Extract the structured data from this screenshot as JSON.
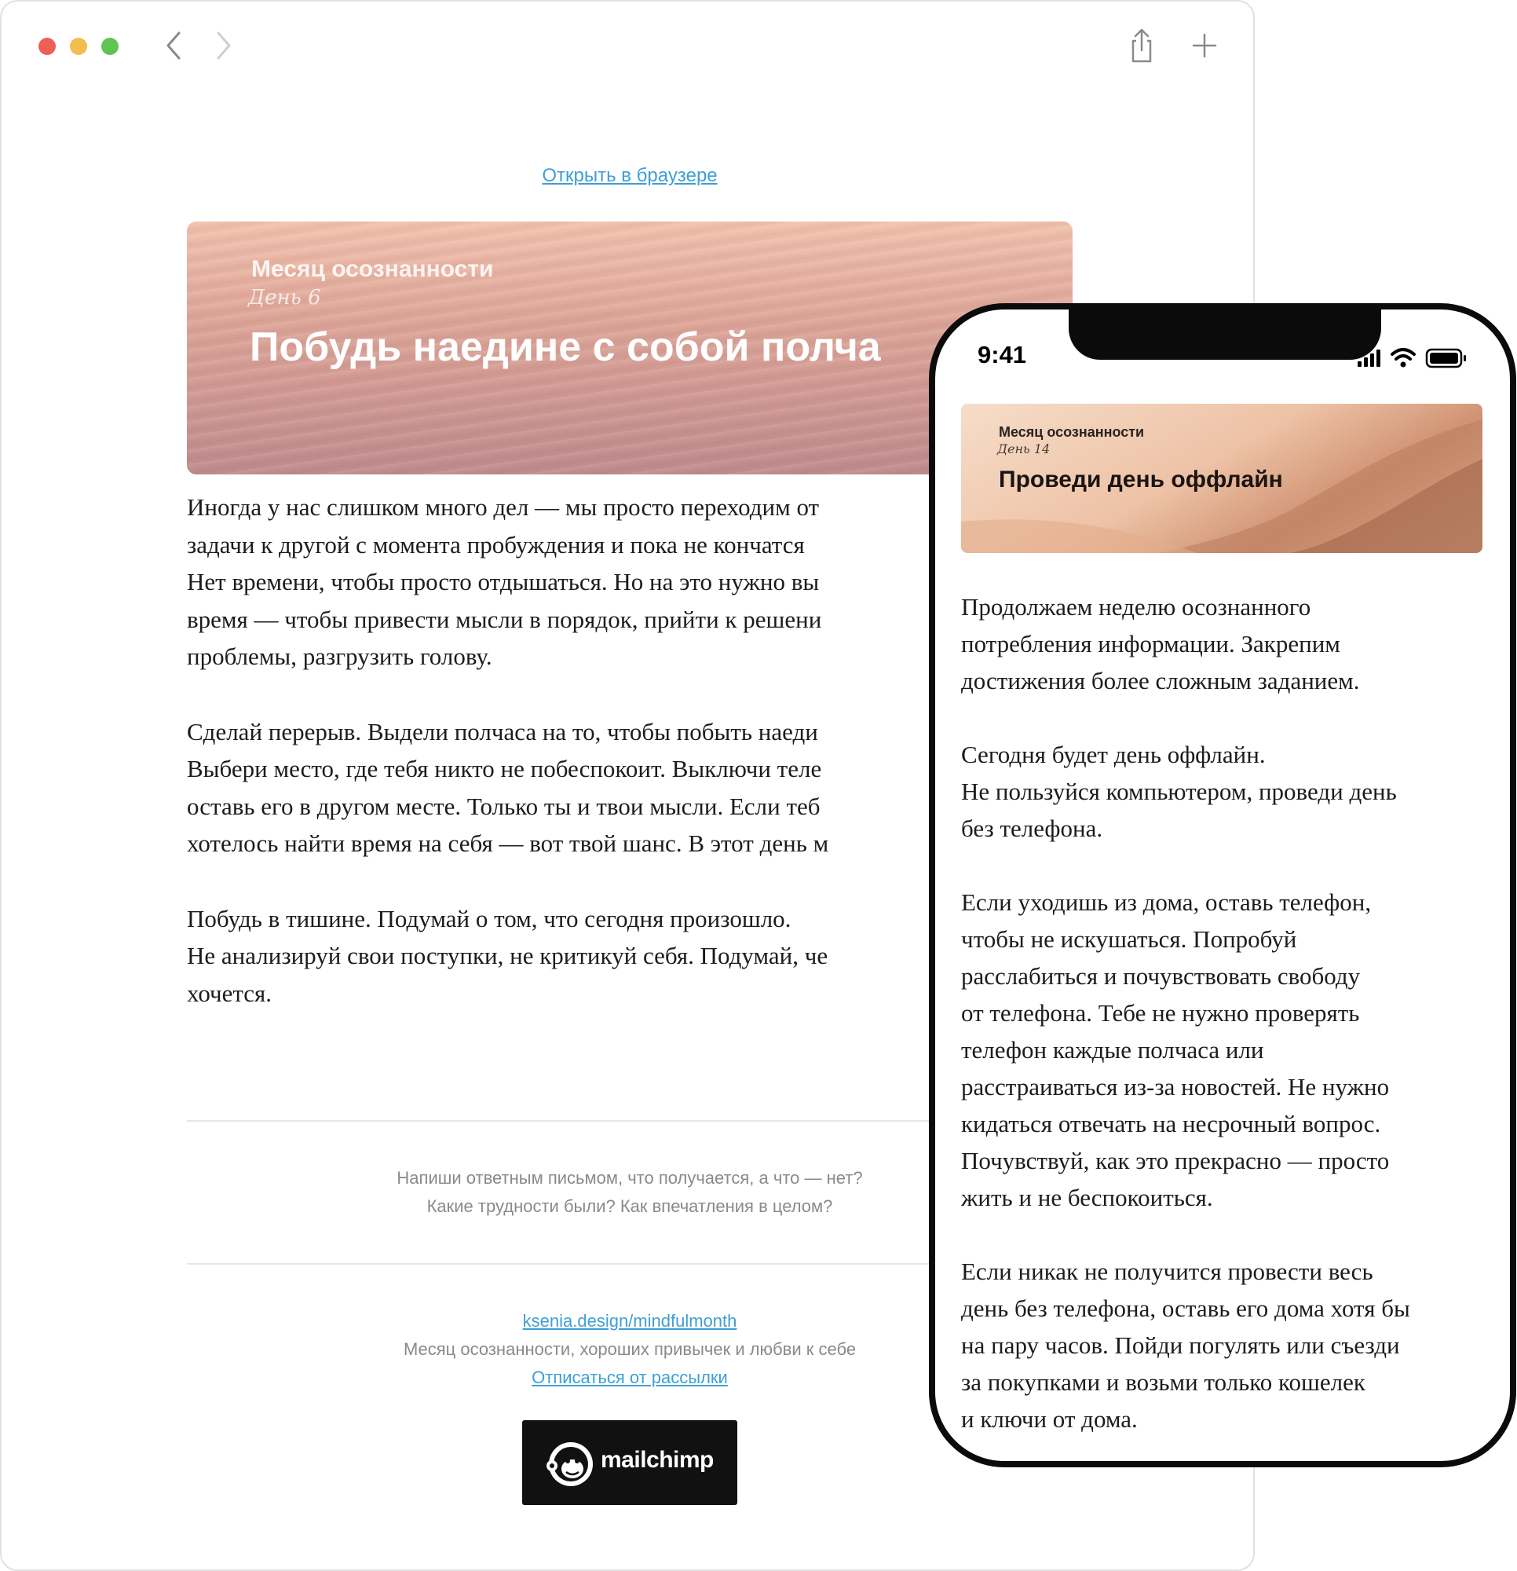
{
  "browser": {
    "open_in_browser": "Открыть в браузере",
    "hero": {
      "series": "Месяц осознанности",
      "day": "День 6",
      "title": "Побудь наедине с собой полча"
    },
    "paragraphs": [
      [
        "Иногда у нас слишком много дел — мы просто переходим от",
        "задачи к другой с момента пробуждения и пока не кончатся",
        "Нет времени, чтобы просто отдышаться. Но на это нужно вы",
        "время — чтобы привести мысли в порядок, прийти к решени",
        "проблемы, разгрузить голову."
      ],
      [
        "Сделай перерыв. Выдели полчаса на то, чтобы побыть наеди",
        "Выбери место, где тебя никто не побеспокоит. Выключи теле",
        "оставь его в другом месте. Только ты и твои мысли. Если теб",
        "хотелось найти время на себя — вот твой шанс. В этот день м"
      ],
      [
        "Побудь в тишине. Подумай о том, что сегодня произошло.",
        "Не анализируй свои поступки, не критикуй себя. Подумай, че",
        "хочется."
      ]
    ],
    "feedback": [
      "Напиши ответным письмом, что получается, а что — нет?",
      "Какие трудности были? Как впечатления в целом?"
    ],
    "footer": {
      "site_link": "ksenia.design/mindfulmonth",
      "tagline": "Месяц осознанности, хороших привычек и любви к себе",
      "unsubscribe": "Отписаться от рассылки"
    },
    "badge_text": "mailchimp"
  },
  "phone": {
    "time": "9:41",
    "hero": {
      "series": "Месяц осознанности",
      "day": "День 14",
      "title": "Проведи день оффлайн"
    },
    "paragraphs": [
      [
        "Продолжаем неделю осознанного",
        "потребления информации. Закрепим",
        "достижения более сложным заданием."
      ],
      [
        "Сегодня будет день оффлайн.",
        "Не пользуйся компьютером, проведи день",
        "без телефона."
      ],
      [
        "Если уходишь из дома, оставь телефон,",
        "чтобы не искушаться. Попробуй",
        "расслабиться и почувствовать свободу",
        "от телефона. Тебе не нужно проверять",
        "телефон каждые полчаса или",
        "расстраиваться из-за новостей. Не нужно",
        "кидаться отвечать на несрочный вопрос.",
        "Почувствуй, как это прекрасно — просто",
        "жить и не беспокоиться."
      ],
      [
        "Если никак не получится провести весь",
        "день без телефона, оставь его дома хотя бы",
        "на пару часов. Пойди погулять или съезди",
        "за покупками и возьми только кошелек",
        "и ключи от дома."
      ]
    ]
  },
  "icons": {
    "back": "chevron-left-icon",
    "forward": "chevron-right-icon",
    "share": "share-icon",
    "new_tab": "plus-icon",
    "signal": "cellular-signal-icon",
    "wifi": "wifi-icon",
    "battery": "battery-icon",
    "brand": "mailchimp-logo"
  },
  "colors": {
    "link": "#3f9fd3",
    "traffic_red": "#ee5f57",
    "traffic_yellow": "#f3bd4f",
    "traffic_green": "#60c454"
  }
}
